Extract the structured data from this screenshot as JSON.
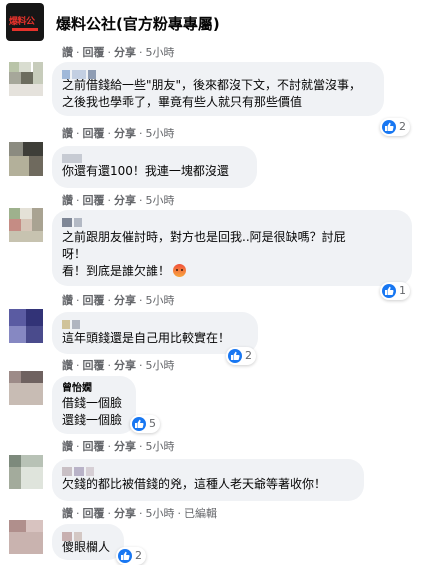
{
  "header": {
    "logo_text": "爆料公",
    "page_name": "爆料公社(官方粉專專屬)"
  },
  "actions": {
    "like": "讚",
    "reply": "回覆",
    "share": "分享",
    "dot": "·",
    "edited": "已編輯"
  },
  "top_row": {
    "time": "5小時"
  },
  "comments": [
    {
      "text": "之前借錢給一些\"朋友\"，後來都沒下文，不討就當沒事，\n之後我也學乖了，畢竟有些人就只有那些價值",
      "time": "5小時",
      "likes": "2"
    },
    {
      "text": "你還有還100！我連一塊都沒還",
      "time": "5小時",
      "likes": ""
    },
    {
      "text": "之前跟朋友催討時，對方也是回我..阿是很缺嗎？討屁\n呀！\n看！到底是誰欠誰！",
      "time": "5小時",
      "likes": "1",
      "emoji": "angry-emoji"
    },
    {
      "text": "這年頭錢還是自己用比較實在！",
      "time": "5小時",
      "likes": "2"
    },
    {
      "author": "曾怡嫺",
      "text": "借錢一個臉\n還錢一個臉",
      "time": "5小時",
      "likes": "5"
    },
    {
      "text": "欠錢的都比被借錢的兇，這種人老天爺等著收你！",
      "time": "5小時",
      "likes": "",
      "edited": true
    },
    {
      "text": "傻眼欄人",
      "time": "",
      "likes": "2"
    }
  ]
}
